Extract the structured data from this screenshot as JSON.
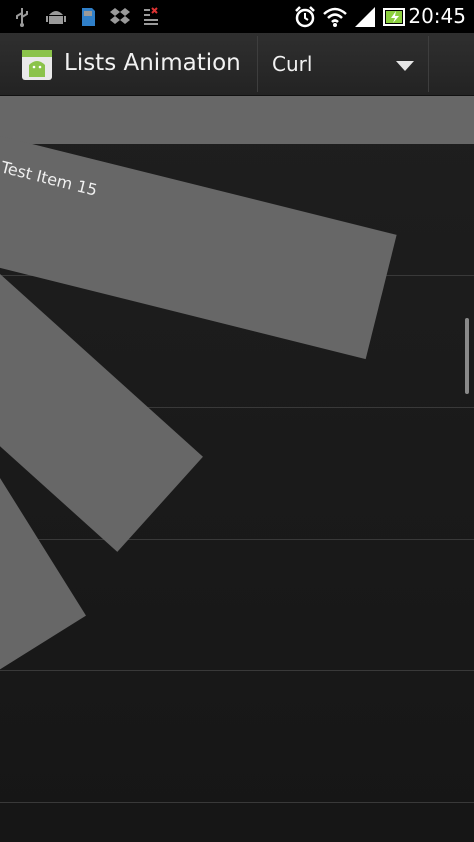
{
  "status_bar": {
    "time": "20:45",
    "left_icons": [
      "usb-icon",
      "android-debug-icon",
      "sd-card-icon",
      "dropbox-icon",
      "notification-icon"
    ],
    "right_icons": [
      "alarm-icon",
      "wifi-icon",
      "signal-icon",
      "battery-charging-icon"
    ]
  },
  "action_bar": {
    "title": "Lists Animation",
    "spinner": {
      "selected": "Curl"
    }
  },
  "list": {
    "items": [
      {
        "label": "Test Item 15"
      }
    ]
  },
  "colors": {
    "card": "#676767",
    "background": "#1b1b1b",
    "actionbar": "#2a2a2a"
  }
}
